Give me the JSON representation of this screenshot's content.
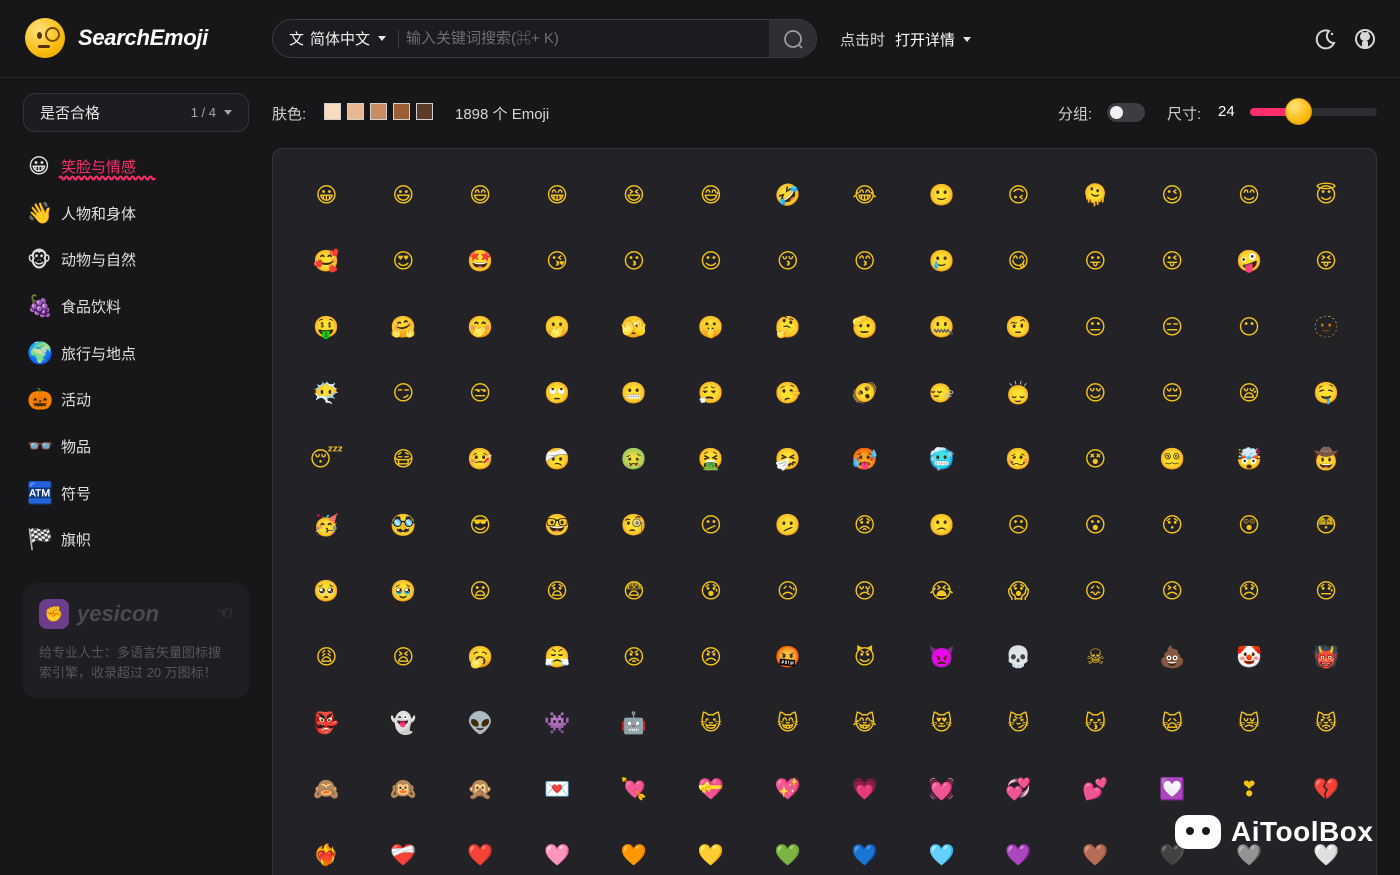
{
  "header": {
    "brand": "SearchEmoji",
    "language": "简体中文",
    "search_placeholder": "输入关键词搜索(⌘+ K)",
    "click_label": "点击时",
    "click_action": "打开详情",
    "icons": [
      "moon-icon",
      "github-icon",
      "search-icon",
      "translate-icon"
    ]
  },
  "sidebar": {
    "select": {
      "label": "是否合格",
      "count": "1 / 4"
    },
    "items": [
      {
        "icon": "😀",
        "label": "笑脸与情感",
        "active": true
      },
      {
        "icon": "👋",
        "label": "人物和身体"
      },
      {
        "icon": "🐵",
        "label": "动物与自然"
      },
      {
        "icon": "🍇",
        "label": "食品饮料"
      },
      {
        "icon": "🌍",
        "label": "旅行与地点"
      },
      {
        "icon": "🎃",
        "label": "活动"
      },
      {
        "icon": "👓",
        "label": "物品"
      },
      {
        "icon": "🏧",
        "label": "符号"
      },
      {
        "icon": "🏁",
        "label": "旗帜"
      }
    ],
    "promo": {
      "brand": "yesicon",
      "text": "给专业人士：多语言矢量图标搜索引擎，收录超过 20 万图标！"
    }
  },
  "toolbar": {
    "skin_label": "肤色:",
    "skin_tones": [
      "#f7dcc0",
      "#e8b895",
      "#c78c62",
      "#9a5f35",
      "#5b3b26"
    ],
    "count_text": "1898 个 Emoji",
    "group_label": "分组:",
    "group_enabled": false,
    "size_label": "尺寸:",
    "size_value": "24",
    "size_fraction": 0.3
  },
  "emojis": [
    "😀",
    "😃",
    "😄",
    "😁",
    "😆",
    "😅",
    "🤣",
    "😂",
    "🙂",
    "🙃",
    "🫠",
    "😉",
    "😊",
    "😇",
    "🥰",
    "😍",
    "🤩",
    "😘",
    "😗",
    "☺",
    "😚",
    "😙",
    "🥲",
    "😋",
    "😛",
    "😜",
    "🤪",
    "😝",
    "🤑",
    "🤗",
    "🤭",
    "🫢",
    "🫣",
    "🤫",
    "🤔",
    "🫡",
    "🤐",
    "🤨",
    "😐",
    "😑",
    "😶",
    "🫥",
    "😶‍🌫️",
    "😏",
    "😒",
    "🙄",
    "😬",
    "😮‍💨",
    "🤥",
    "🫨",
    "🙂‍↔️",
    "🙂‍↕️",
    "😌",
    "😔",
    "😪",
    "🤤",
    "😴",
    "😷",
    "🤒",
    "🤕",
    "🤢",
    "🤮",
    "🤧",
    "🥵",
    "🥶",
    "🥴",
    "😵",
    "😵‍💫",
    "🤯",
    "🤠",
    "🥳",
    "🥸",
    "😎",
    "🤓",
    "🧐",
    "😕",
    "🫤",
    "😟",
    "🙁",
    "☹",
    "😮",
    "😯",
    "😲",
    "😳",
    "🥺",
    "🥹",
    "😦",
    "😧",
    "😨",
    "😰",
    "😥",
    "😢",
    "😭",
    "😱",
    "😖",
    "😣",
    "😞",
    "😓",
    "😩",
    "😫",
    "🥱",
    "😤",
    "😡",
    "😠",
    "🤬",
    "😈",
    "👿",
    "💀",
    "☠",
    "💩",
    "🤡",
    "👹",
    "👺",
    "👻",
    "👽",
    "👾",
    "🤖",
    "😺",
    "😸",
    "😹",
    "😻",
    "😼",
    "😽",
    "🙀",
    "😿",
    "😾",
    "🙈",
    "🙉",
    "🙊",
    "💌",
    "💘",
    "💝",
    "💖",
    "💗",
    "💓",
    "💞",
    "💕",
    "💟",
    "❣",
    "💔",
    "❤️‍🔥",
    "❤️‍🩹",
    "❤️",
    "🩷",
    "🧡",
    "💛",
    "💚",
    "💙",
    "🩵",
    "💜",
    "🤎",
    "🖤",
    "🩶",
    "🤍"
  ],
  "watermark": "AiToolBox"
}
